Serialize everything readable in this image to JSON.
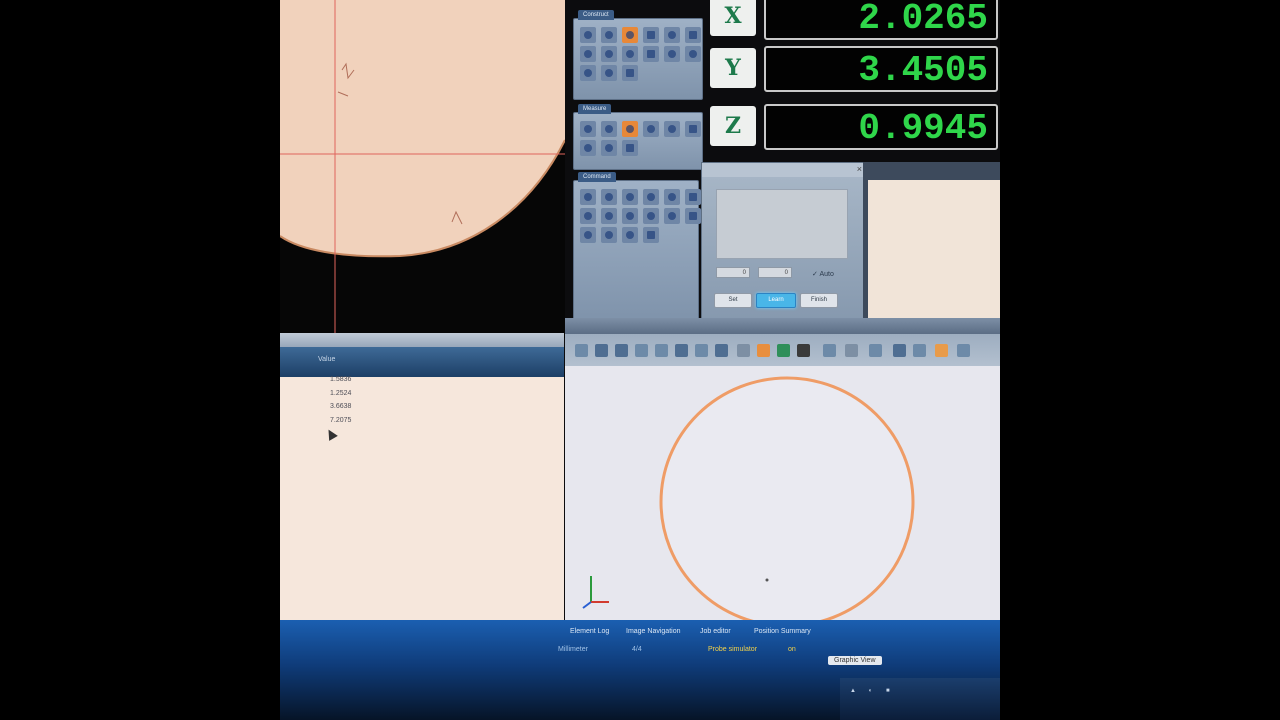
{
  "dro": {
    "x": {
      "axis": "X",
      "value": "2.0265"
    },
    "y": {
      "axis": "Y",
      "value": "3.4505"
    },
    "z": {
      "axis": "Z",
      "value": "0.9945"
    }
  },
  "panels": {
    "construct_title": "Construct",
    "measure_title": "Measure",
    "command_title": "Command"
  },
  "dialog": {
    "spin1": "0",
    "spin2": "0",
    "auto_label": "Auto",
    "set_label": "Set",
    "learn_label": "Learn",
    "finish_label": "Finish"
  },
  "results": {
    "column_header": "Value",
    "values": [
      "1.5836",
      "1.2524",
      "3.6638",
      "7.2075"
    ]
  },
  "taskbar": {
    "tabs": [
      "Element Log",
      "Image Navigation",
      "Job editor",
      "Position Summary",
      "Graphic View"
    ],
    "items": [
      "Millimeter",
      "4/4",
      "Probe simulator",
      "on"
    ]
  },
  "colors": {
    "dro_digits": "#2fd64a",
    "highlight_tool": "#e78838",
    "measured_circle": "#ef9c66",
    "crosshair": "#e0645c"
  }
}
